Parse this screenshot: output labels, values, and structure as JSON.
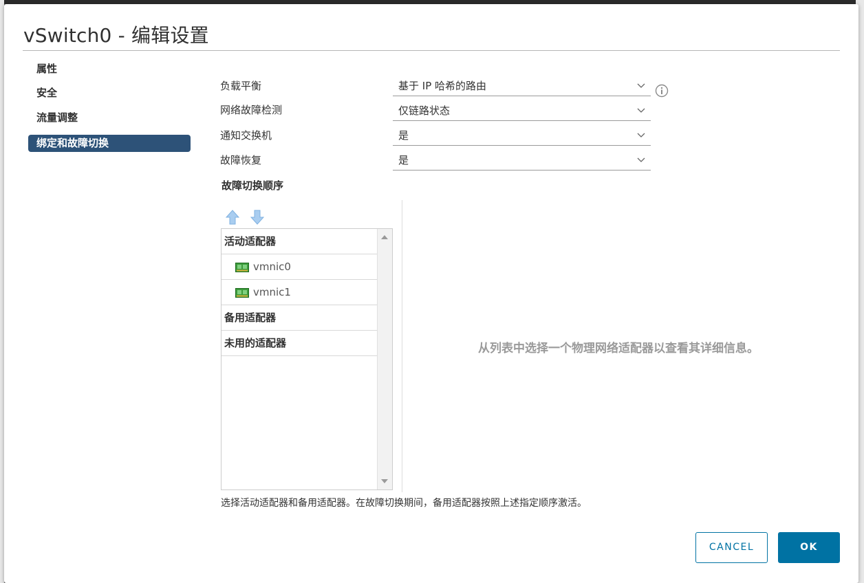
{
  "dialog": {
    "title": "vSwitch0 - 编辑设置"
  },
  "nav": {
    "items": [
      {
        "label": "属性",
        "active": false
      },
      {
        "label": "安全",
        "active": false
      },
      {
        "label": "流量调整",
        "active": false
      },
      {
        "label": "绑定和故障切换",
        "active": true
      }
    ]
  },
  "form": {
    "load_balancing": {
      "label": "负载平衡",
      "value": "基于 IP 哈希的路由"
    },
    "network_failure_detection": {
      "label": "网络故障检测",
      "value": "仅链路状态"
    },
    "notify_switches": {
      "label": "通知交换机",
      "value": "是"
    },
    "failback": {
      "label": "故障恢复",
      "value": "是"
    }
  },
  "failover": {
    "title": "故障切换顺序",
    "groups": {
      "active": "活动适配器",
      "standby": "备用适配器",
      "unused": "未用的适配器"
    },
    "active_adapters": [
      "vmnic0",
      "vmnic1"
    ],
    "empty_message": "从列表中选择一个物理网络适配器以查看其详细信息。",
    "hint": "选择活动适配器和备用适配器。在故障切换期间，备用适配器按照上述指定顺序激活。"
  },
  "footer": {
    "cancel_label": "CANCEL",
    "ok_label": "OK"
  },
  "icons": {
    "move_up": "arrow-up-icon",
    "move_down": "arrow-down-icon",
    "info": "info-icon",
    "nic": "network-adapter-icon"
  },
  "colors": {
    "accent": "#0072a3",
    "nav_active": "#2d5278"
  }
}
